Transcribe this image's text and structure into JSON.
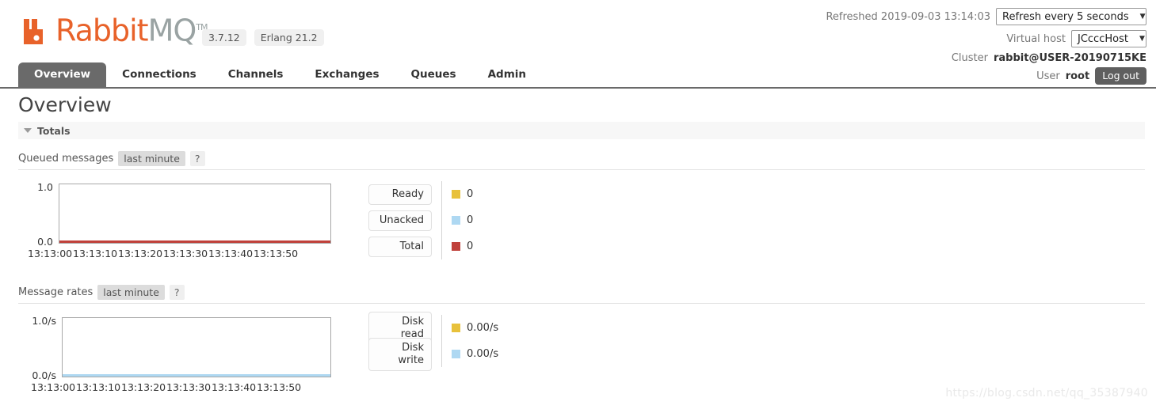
{
  "header": {
    "logo": {
      "icon": "rabbitmq-logo-icon",
      "text_primary": "Rabbit",
      "text_secondary": "MQ",
      "trademark": "TM"
    },
    "badges": [
      {
        "label": "3.7.12"
      },
      {
        "label": "Erlang 21.2"
      }
    ],
    "refreshed_text": "Refreshed 2019-09-03 13:14:03",
    "refresh_select": {
      "value": "Refresh every 5 seconds",
      "options": [
        "Refresh every 5 seconds"
      ],
      "caret": "▼"
    },
    "vhost_label": "Virtual host",
    "vhost_select": {
      "value": "JCcccHost",
      "options": [
        "JCcccHost"
      ],
      "caret": "▼"
    },
    "cluster_label": "Cluster",
    "cluster_value": "rabbit@USER-20190715KE",
    "user_label": "User",
    "user_value": "root",
    "logout_label": "Log out"
  },
  "nav": {
    "tabs": [
      {
        "label": "Overview",
        "active": true
      },
      {
        "label": "Connections",
        "active": false
      },
      {
        "label": "Channels",
        "active": false
      },
      {
        "label": "Exchanges",
        "active": false
      },
      {
        "label": "Queues",
        "active": false
      },
      {
        "label": "Admin",
        "active": false
      }
    ]
  },
  "main": {
    "page_title": "Overview",
    "totals_section": {
      "label": "Totals",
      "toggle_icon": "chevron-down-icon"
    },
    "queued_messages": {
      "heading": "Queued messages",
      "period_pill": "last minute",
      "help_pill": "?",
      "legend": [
        {
          "label": "Ready",
          "color": "#e8c13b",
          "value": "0"
        },
        {
          "label": "Unacked",
          "color": "#aed8f2",
          "value": "0"
        },
        {
          "label": "Total",
          "color": "#c0413b",
          "value": "0"
        }
      ]
    },
    "message_rates": {
      "heading": "Message rates",
      "period_pill": "last minute",
      "help_pill": "?",
      "legend": [
        {
          "label": "Disk read",
          "color": "#e8c13b",
          "value": "0.00/s"
        },
        {
          "label": "Disk write",
          "color": "#aed8f2",
          "value": "0.00/s"
        }
      ]
    }
  },
  "watermark": "https://blog.csdn.net/qq_35387940",
  "chart_data": [
    {
      "type": "line",
      "title": "Queued messages",
      "xlabel": "",
      "ylabel": "",
      "ylim": [
        0.0,
        1.0
      ],
      "ytick_labels": [
        "1.0",
        "0.0"
      ],
      "grid": false,
      "legend_position": "right",
      "x": [
        "13:13:00",
        "13:13:10",
        "13:13:20",
        "13:13:30",
        "13:13:40",
        "13:13:50"
      ],
      "series": [
        {
          "name": "Ready",
          "color": "#e8c13b",
          "values": [
            0,
            0,
            0,
            0,
            0,
            0
          ]
        },
        {
          "name": "Unacked",
          "color": "#aed8f2",
          "values": [
            0,
            0,
            0,
            0,
            0,
            0
          ]
        },
        {
          "name": "Total",
          "color": "#c0413b",
          "values": [
            0,
            0,
            0,
            0,
            0,
            0
          ]
        }
      ]
    },
    {
      "type": "line",
      "title": "Message rates",
      "xlabel": "",
      "ylabel": "",
      "ylim": [
        0.0,
        1.0
      ],
      "ytick_labels": [
        "1.0/s",
        "0.0/s"
      ],
      "grid": false,
      "legend_position": "right",
      "x": [
        "13:13:00",
        "13:13:10",
        "13:13:20",
        "13:13:30",
        "13:13:40",
        "13:13:50"
      ],
      "series": [
        {
          "name": "Disk read",
          "color": "#e8c13b",
          "values": [
            0,
            0,
            0,
            0,
            0,
            0
          ]
        },
        {
          "name": "Disk write",
          "color": "#aed8f2",
          "values": [
            0,
            0,
            0,
            0,
            0,
            0
          ]
        }
      ]
    }
  ]
}
